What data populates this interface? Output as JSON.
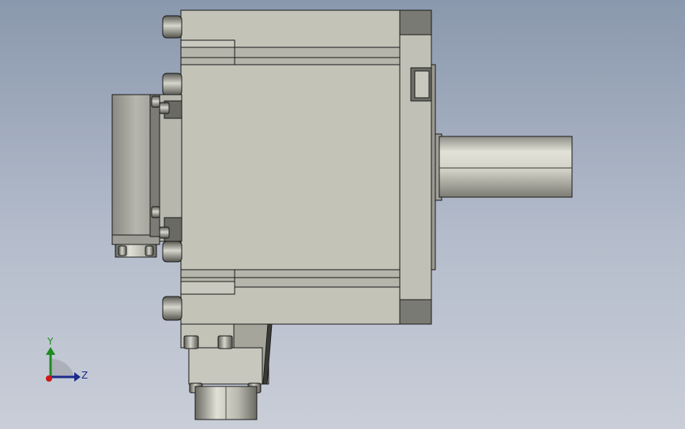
{
  "viewport": {
    "background_top": "#8a98ad",
    "background_bottom": "#c9ced8"
  },
  "colors": {
    "body": "#c3c3b8",
    "body_dark": "#6e6e68",
    "flange": "#a9a9a2",
    "shaft_light": "#d8d8cf",
    "shaft_dark": "#8e8e86",
    "outline": "#1a1a1a",
    "axis_x": "#1c2a8a",
    "axis_y": "#1f8a1f",
    "origin": "#d01818"
  },
  "triad": {
    "y_label": "Y",
    "z_label": "Z",
    "icon": "coordinate-triad-icon"
  }
}
